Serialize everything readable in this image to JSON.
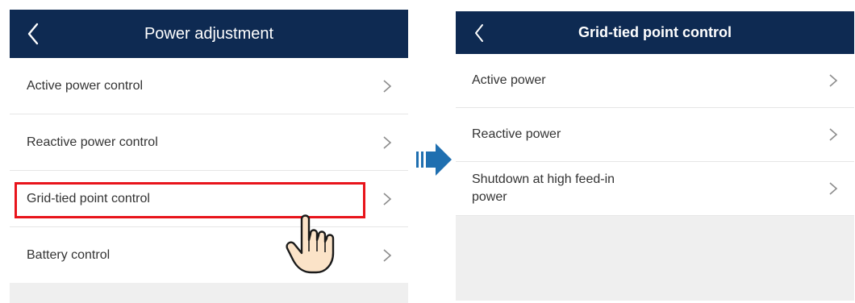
{
  "left_screen": {
    "title": "Power adjustment",
    "items": [
      {
        "label": "Active power control"
      },
      {
        "label": "Reactive power control"
      },
      {
        "label": "Grid-tied point control"
      },
      {
        "label": "Battery control"
      }
    ]
  },
  "right_screen": {
    "title": "Grid-tied point control",
    "items": [
      {
        "label": "Active power"
      },
      {
        "label": "Reactive power"
      },
      {
        "label": "Shutdown at high feed-in\npower"
      }
    ]
  },
  "icons": {
    "back": "chevron-left-icon",
    "row_arrow": "chevron-right-icon",
    "pointer": "hand-pointer-icon",
    "flow": "arrow-right-icon"
  },
  "colors": {
    "navbar": "#0e2a52",
    "highlight": "#e8141b",
    "flow_arrow": "#1f6fb0",
    "empty_area": "#efefef"
  }
}
